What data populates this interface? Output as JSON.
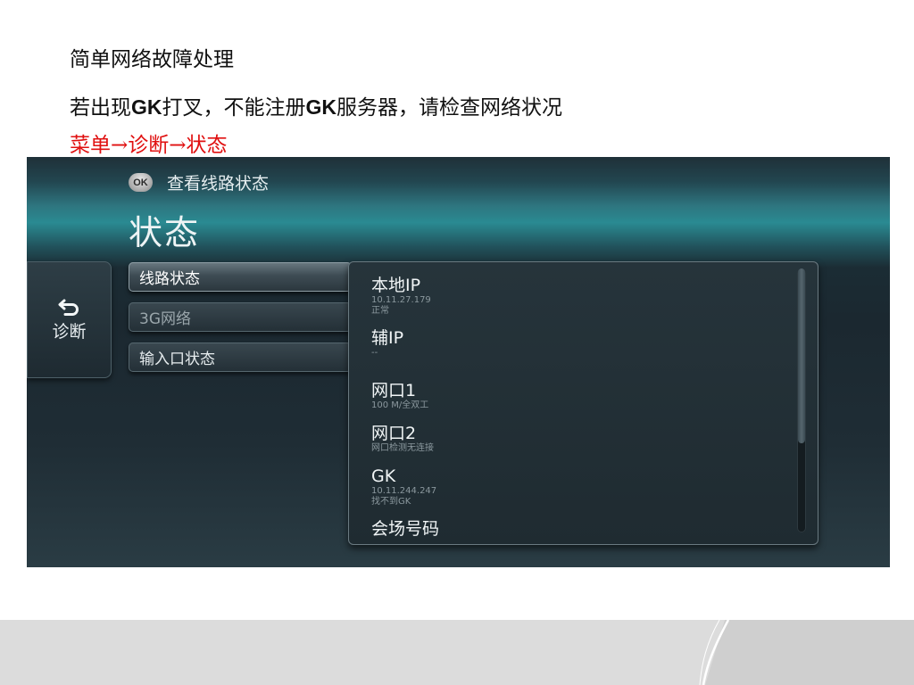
{
  "slide": {
    "title": "简单网络故障处理",
    "line_prefix": "若出现",
    "line_gk1": "GK",
    "line_middle": "打叉，不能注册",
    "line_gk2": "GK",
    "line_suffix": "服务器，请检查网络状况",
    "menu_path": "菜单→诊断→状态",
    "menu_path_color": "#e01010"
  },
  "screen": {
    "ok_badge": "OK",
    "hint": "查看线路状态",
    "title": "状态",
    "back_label": "诊断",
    "back_icon": "return-arrow-icon",
    "menu_items": [
      {
        "label": "线路状态",
        "state": "active"
      },
      {
        "label": "3G网络",
        "state": "disabled"
      },
      {
        "label": "输入口状态",
        "state": "normal"
      }
    ],
    "details": [
      {
        "label": "本地IP",
        "lines": [
          "10.11.27.179",
          "正常"
        ]
      },
      {
        "label": "辅IP",
        "lines": [
          "--"
        ]
      },
      {
        "label": "网口1",
        "lines": [
          "100 M/全双工"
        ]
      },
      {
        "label": "网口2",
        "lines": [
          "网口检测无连接"
        ]
      },
      {
        "label": "GK",
        "lines": [
          "10.11.244.247",
          "找不到GK"
        ]
      },
      {
        "label": "会场号码",
        "lines": []
      }
    ]
  }
}
